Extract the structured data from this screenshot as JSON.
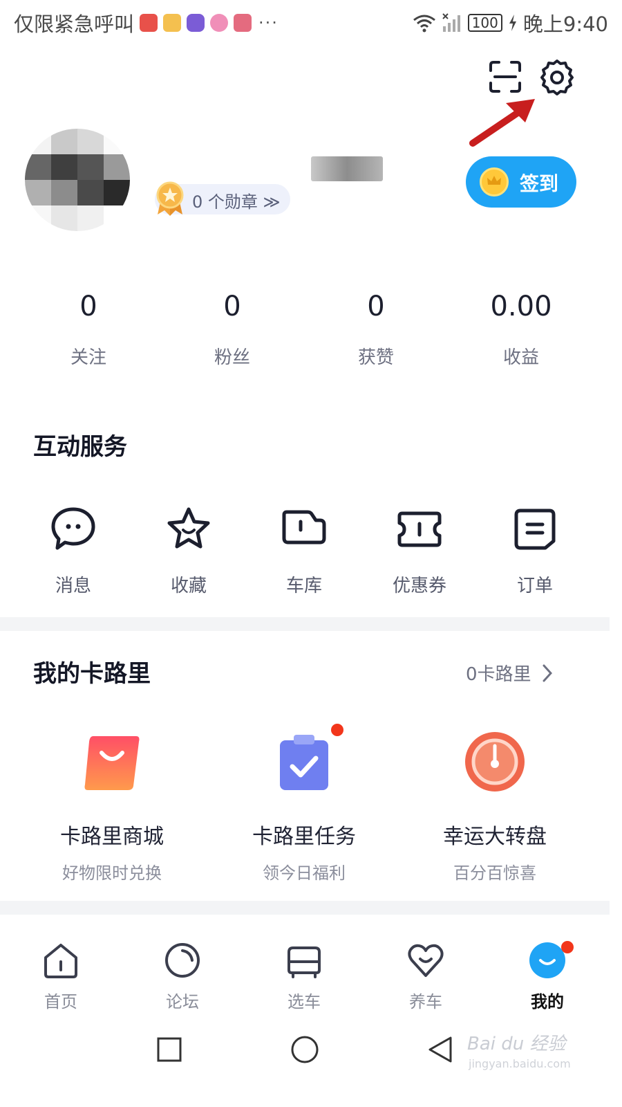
{
  "status_bar": {
    "carrier": "仅限紧急呼叫",
    "battery": "100",
    "time": "晚上9:40",
    "notification_icons": [
      "#e8514a",
      "#f4c04f",
      "#7b5cd6",
      "#f08fb8",
      "#e46b7f"
    ]
  },
  "header": {
    "scan_icon": "scan-icon",
    "settings_icon": "gear-icon"
  },
  "profile": {
    "medal_text": "0 个勋章 ≫",
    "checkin_label": "签到"
  },
  "stats": [
    {
      "value": "0",
      "label": "关注"
    },
    {
      "value": "0",
      "label": "粉丝"
    },
    {
      "value": "0",
      "label": "获赞"
    },
    {
      "value": "0.00",
      "label": "收益"
    }
  ],
  "interactive_services": {
    "title": "互动服务",
    "items": [
      {
        "label": "消息",
        "icon": "message-icon"
      },
      {
        "label": "收藏",
        "icon": "star-icon"
      },
      {
        "label": "车库",
        "icon": "garage-icon"
      },
      {
        "label": "优惠券",
        "icon": "coupon-icon"
      },
      {
        "label": "订单",
        "icon": "order-icon"
      }
    ]
  },
  "calories": {
    "title": "我的卡路里",
    "balance": "0卡路里",
    "items": [
      {
        "title": "卡路里商城",
        "subtitle": "好物限时兑换",
        "icon": "shopping-bag-icon"
      },
      {
        "title": "卡路里任务",
        "subtitle": "领今日福利",
        "icon": "task-clipboard-icon"
      },
      {
        "title": "幸运大转盘",
        "subtitle": "百分百惊喜",
        "icon": "lucky-wheel-icon"
      }
    ]
  },
  "tab_bar": [
    {
      "label": "首页",
      "icon": "home-icon"
    },
    {
      "label": "论坛",
      "icon": "forum-icon"
    },
    {
      "label": "选车",
      "icon": "car-icon"
    },
    {
      "label": "养车",
      "icon": "heart-icon"
    },
    {
      "label": "我的",
      "icon": "profile-icon",
      "active": true
    }
  ],
  "watermark": {
    "text": "Bai du 经验",
    "sub": "jingyan.baidu.com"
  },
  "colors": {
    "accent_blue": "#1fa4f5",
    "notification_red": "#f2361b",
    "annotation_arrow": "#c81e1e"
  }
}
